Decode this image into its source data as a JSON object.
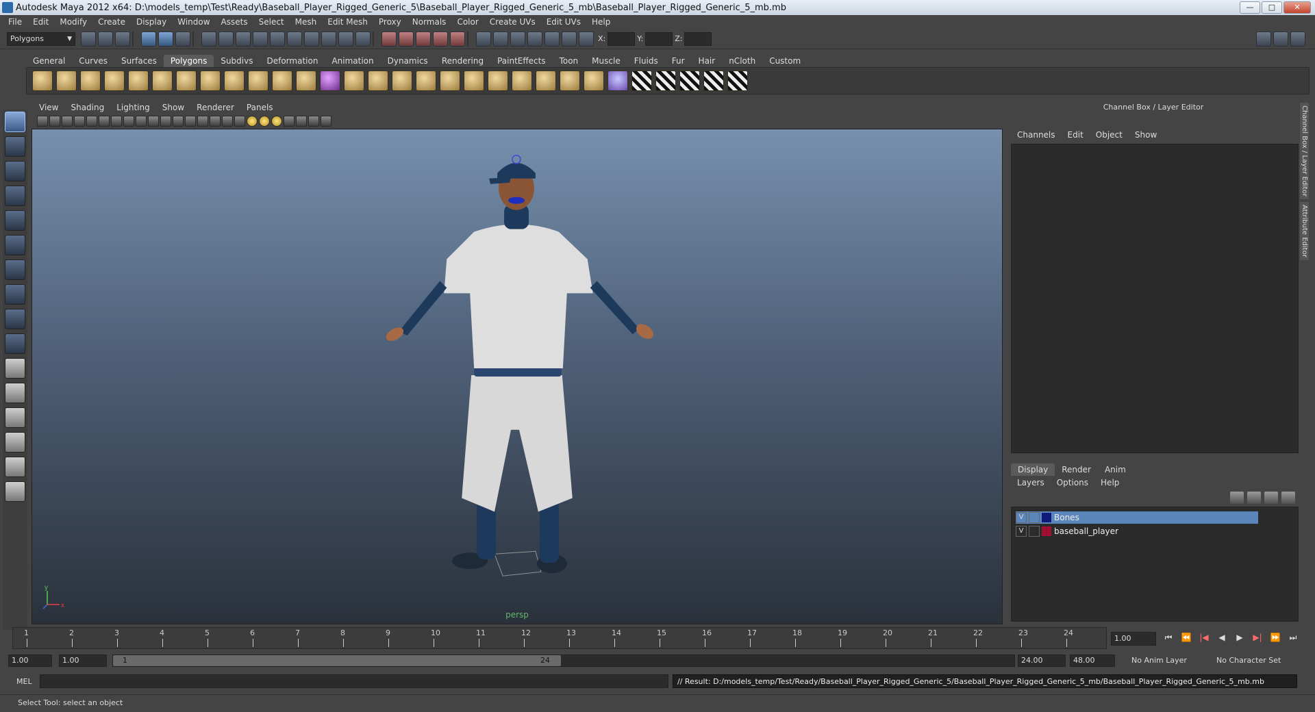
{
  "window": {
    "title": "Autodesk Maya 2012 x64: D:\\models_temp\\Test\\Ready\\Baseball_Player_Rigged_Generic_5\\Baseball_Player_Rigged_Generic_5_mb\\Baseball_Player_Rigged_Generic_5_mb.mb",
    "minimize": "—",
    "maximize": "□",
    "close": "✕"
  },
  "menus": [
    "File",
    "Edit",
    "Modify",
    "Create",
    "Display",
    "Window",
    "Assets",
    "Select",
    "Mesh",
    "Edit Mesh",
    "Proxy",
    "Normals",
    "Color",
    "Create UVs",
    "Edit UVs",
    "Help"
  ],
  "statusline": {
    "mode": "Polygons",
    "x_label": "X:",
    "y_label": "Y:",
    "z_label": "Z:"
  },
  "shelf_tabs": [
    "General",
    "Curves",
    "Surfaces",
    "Polygons",
    "Subdivs",
    "Deformation",
    "Animation",
    "Dynamics",
    "Rendering",
    "PaintEffects",
    "Toon",
    "Muscle",
    "Fluids",
    "Fur",
    "Hair",
    "nCloth",
    "Custom"
  ],
  "shelf_active": "Polygons",
  "panel_menu": [
    "View",
    "Shading",
    "Lighting",
    "Show",
    "Renderer",
    "Panels"
  ],
  "viewport": {
    "camera_label": "persp",
    "axis_x": "x",
    "axis_y": "y"
  },
  "channel_box": {
    "title": "Channel Box / Layer Editor",
    "menu": [
      "Channels",
      "Edit",
      "Object",
      "Show"
    ]
  },
  "layer_editor": {
    "tabs": [
      "Display",
      "Render",
      "Anim"
    ],
    "active_tab": "Display",
    "menu": [
      "Layers",
      "Options",
      "Help"
    ],
    "layers": [
      {
        "visible": "V",
        "name": "Bones",
        "color": "#0f1a7a",
        "selected": true
      },
      {
        "visible": "V",
        "name": "baseball_player",
        "color": "#a01030",
        "selected": false
      }
    ]
  },
  "side_tabs": [
    "Channel Box / Layer Editor",
    "Attribute Editor"
  ],
  "timeline": {
    "frames": [
      "1",
      "2",
      "3",
      "4",
      "5",
      "6",
      "7",
      "8",
      "9",
      "10",
      "11",
      "12",
      "13",
      "14",
      "15",
      "16",
      "17",
      "18",
      "19",
      "20",
      "21",
      "22",
      "23",
      "24"
    ],
    "current_frame": "1.00"
  },
  "playback_buttons": [
    "⏮",
    "⏪",
    "|◀",
    "◀",
    "▶",
    "▶|",
    "⏩",
    "⏭"
  ],
  "range": {
    "start_time": "1.00",
    "playback_start": "1.00",
    "slider_start": "1",
    "slider_end": "24",
    "playback_end": "24.00",
    "end_time": "48.00",
    "anim_layer": "No Anim Layer",
    "character_set": "No Character Set"
  },
  "command_line": {
    "language": "MEL",
    "result": "// Result: D:/models_temp/Test/Ready/Baseball_Player_Rigged_Generic_5/Baseball_Player_Rigged_Generic_5_mb/Baseball_Player_Rigged_Generic_5_mb.mb"
  },
  "help_line": "Select Tool: select an object"
}
